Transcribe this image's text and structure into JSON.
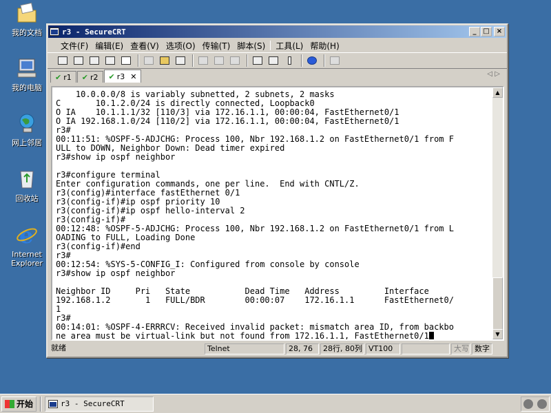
{
  "desktop": {
    "icons": [
      {
        "label": "我的文档",
        "icon": "my-documents-icon"
      },
      {
        "label": "我的电脑",
        "icon": "my-computer-icon"
      },
      {
        "label": "网上邻居",
        "icon": "network-icon"
      },
      {
        "label": "回收站",
        "icon": "recycle-bin-icon"
      },
      {
        "label": "Internet\nExplorer",
        "icon": "ie-icon"
      }
    ]
  },
  "window": {
    "title": "r3 - SecureCRT",
    "menu": [
      "文件(F)",
      "编辑(E)",
      "查看(V)",
      "选项(O)",
      "传输(T)",
      "脚本(S)",
      "工具(L)",
      "帮助(H)"
    ],
    "tabs": [
      {
        "label": "r1",
        "active": false
      },
      {
        "label": "r2",
        "active": false
      },
      {
        "label": "r3",
        "active": true
      }
    ]
  },
  "terminal": {
    "lines": [
      "    10.0.0.0/8 is variably subnetted, 2 subnets, 2 masks",
      "C       10.1.2.0/24 is directly connected, Loopback0",
      "O IA    10.1.1.1/32 [110/3] via 172.16.1.1, 00:00:04, FastEthernet0/1",
      "O IA 192.168.1.0/24 [110/2] via 172.16.1.1, 00:00:04, FastEthernet0/1",
      "r3#",
      "00:11:51: %OSPF-5-ADJCHG: Process 100, Nbr 192.168.1.2 on FastEthernet0/1 from F",
      "ULL to DOWN, Neighbor Down: Dead timer expired",
      "r3#show ip ospf neighbor",
      "",
      "r3#configure terminal",
      "Enter configuration commands, one per line.  End with CNTL/Z.",
      "r3(config)#interface fastEthernet 0/1",
      "r3(config-if)#ip ospf priority 10",
      "r3(config-if)#ip ospf hello-interval 2",
      "r3(config-if)#",
      "00:12:48: %OSPF-5-ADJCHG: Process 100, Nbr 192.168.1.2 on FastEthernet0/1 from L",
      "OADING to FULL, Loading Done",
      "r3(config-if)#end",
      "r3#",
      "00:12:54: %SYS-5-CONFIG_I: Configured from console by console",
      "r3#show ip ospf neighbor",
      "",
      "Neighbor ID     Pri   State           Dead Time   Address         Interface",
      "192.168.1.2       1   FULL/BDR        00:00:07    172.16.1.1      FastEthernet0/",
      "1",
      "r3#",
      "00:14:01: %OSPF-4-ERRRCV: Received invalid packet: mismatch area ID, from backbo",
      "ne area must be virtual-link but not found from 172.16.1.1, FastEthernet0/1"
    ]
  },
  "status": {
    "ready": "就绪",
    "protocol": "Telnet",
    "cursor_pos": "28, 76",
    "size": "28行, 80列",
    "emulation": "VT100",
    "caps": "大写",
    "num": "数字"
  },
  "taskbar": {
    "start_label": "开始",
    "task_label": "r3 - SecureCRT"
  }
}
